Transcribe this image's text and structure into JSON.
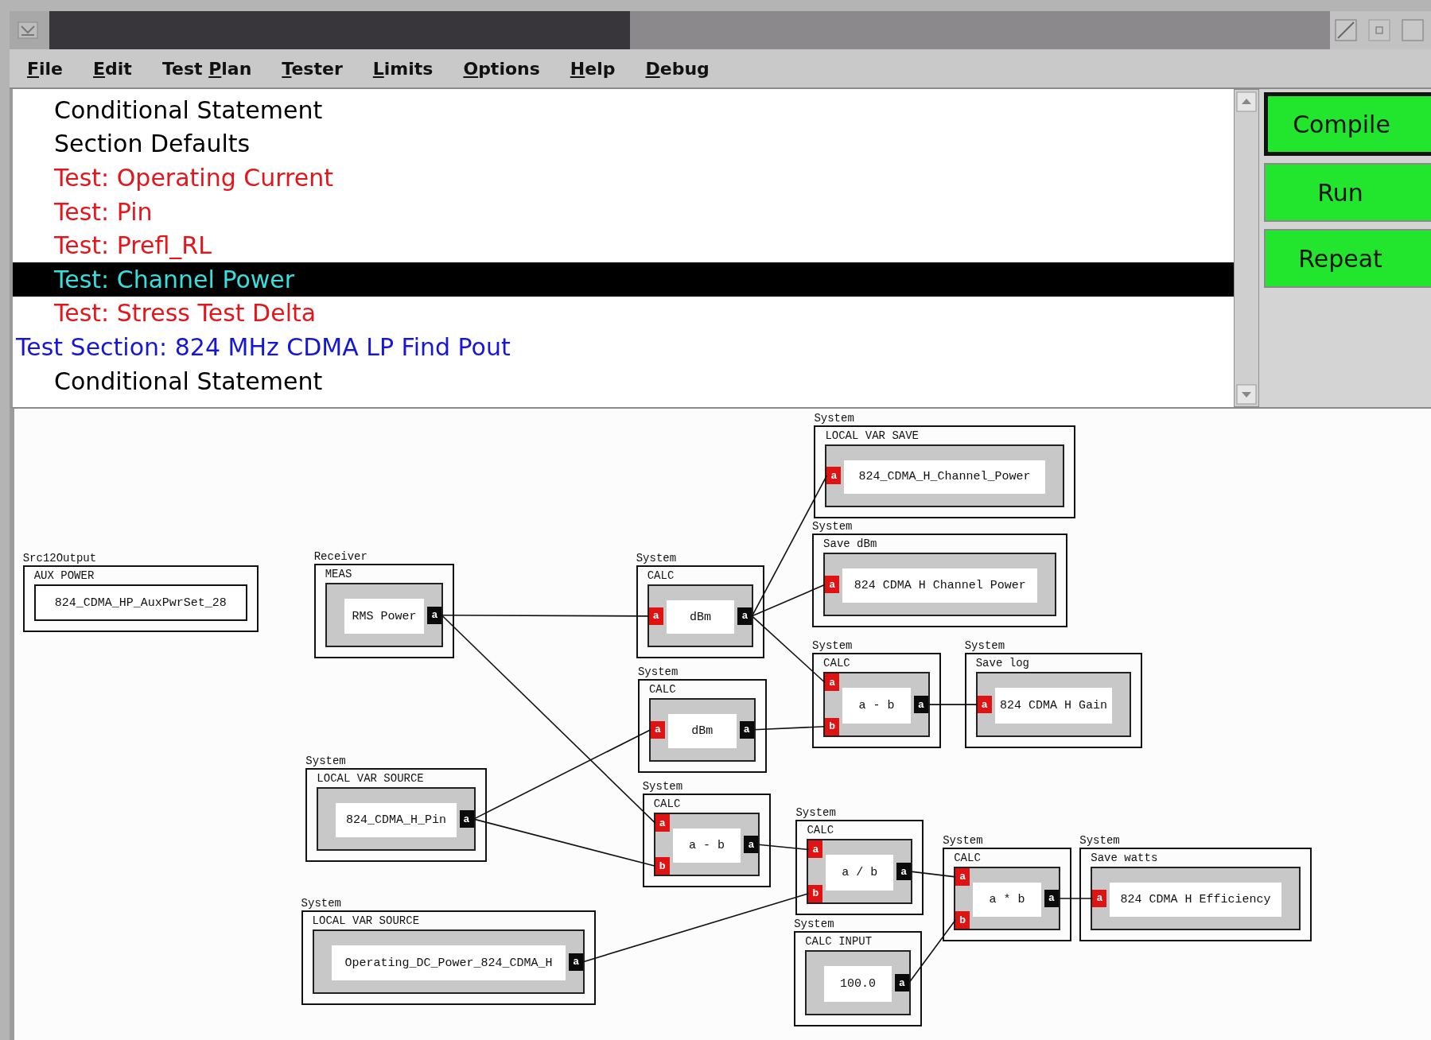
{
  "menu": [
    {
      "key": "F",
      "after": "ile"
    },
    {
      "key": "E",
      "after": "dit"
    },
    {
      "before": "Test ",
      "key": "P",
      "after": "lan"
    },
    {
      "key": "T",
      "after": "ester"
    },
    {
      "key": "L",
      "after": "imits"
    },
    {
      "key": "O",
      "after": "ptions"
    },
    {
      "key": "H",
      "after": "elp"
    },
    {
      "key": "D",
      "after": "ebug"
    }
  ],
  "plan_list": [
    {
      "label": "Conditional Statement",
      "kind": "step",
      "color": "#000000",
      "selected": false
    },
    {
      "label": "Section Defaults",
      "kind": "step",
      "color": "#000000",
      "selected": false
    },
    {
      "label": "Test: Operating Current",
      "kind": "step",
      "color": "#e3161c",
      "selected": false
    },
    {
      "label": "Test: Pin",
      "kind": "step",
      "color": "#e3161c",
      "selected": false
    },
    {
      "label": "Test: Prefl_RL",
      "kind": "step",
      "color": "#e3161c",
      "selected": false
    },
    {
      "label": "Test: Channel Power",
      "kind": "step",
      "color": "#36dede",
      "selected": true
    },
    {
      "label": "Test: Stress Test Delta",
      "kind": "step",
      "color": "#e3161c",
      "selected": false
    },
    {
      "label": "Test Section: 824 MHz CDMA LP Find Pout",
      "kind": "section",
      "color": "#1616d6",
      "selected": false
    },
    {
      "label": "Conditional Statement",
      "kind": "step",
      "color": "#000000",
      "selected": false
    }
  ],
  "actions": [
    {
      "label": "Compile",
      "default": true
    },
    {
      "label": "Run",
      "default": false
    },
    {
      "label": "Repeat",
      "default": false
    }
  ],
  "diagram": {
    "nodes": [
      {
        "kind": "plain",
        "category": "Src12Output",
        "title": "AUX POWER",
        "value": "824_CDMA_HP_AuxPwrSet_28"
      },
      {
        "kind": "block",
        "category": "Receiver",
        "title": "MEAS",
        "value": "RMS Power",
        "outputs": [
          "a"
        ]
      },
      {
        "kind": "block",
        "category": "System",
        "title": "CALC",
        "value": "dBm",
        "inputs": [
          "a"
        ],
        "outputs": [
          "a"
        ]
      },
      {
        "kind": "block",
        "category": "System",
        "title": "LOCAL VAR SAVE",
        "value": "824_CDMA_H_Channel_Power",
        "inputs": [
          "a"
        ]
      },
      {
        "kind": "block",
        "category": "System",
        "title": "Save dBm",
        "value": "824 CDMA H Channel Power",
        "inputs": [
          "a"
        ]
      },
      {
        "kind": "block",
        "category": "System",
        "title": "CALC",
        "value": "a - b",
        "inputs": [
          "a",
          "b"
        ],
        "outputs": [
          "a"
        ]
      },
      {
        "kind": "block",
        "category": "System",
        "title": "Save log",
        "value": "824 CDMA H Gain",
        "inputs": [
          "a"
        ]
      },
      {
        "kind": "block",
        "category": "System",
        "title": "CALC",
        "value": "dBm",
        "inputs": [
          "a"
        ],
        "outputs": [
          "a"
        ]
      },
      {
        "kind": "block",
        "category": "System",
        "title": "LOCAL VAR SOURCE",
        "value": "824_CDMA_H_Pin",
        "outputs": [
          "a"
        ]
      },
      {
        "kind": "block",
        "category": "System",
        "title": "CALC",
        "value": "a - b",
        "inputs": [
          "a",
          "b"
        ],
        "outputs": [
          "a"
        ]
      },
      {
        "kind": "block",
        "category": "System",
        "title": "CALC",
        "value": "a / b",
        "inputs": [
          "a",
          "b"
        ],
        "outputs": [
          "a"
        ]
      },
      {
        "kind": "block",
        "category": "System",
        "title": "LOCAL VAR SOURCE",
        "value": "Operating_DC_Power_824_CDMA_H",
        "outputs": [
          "a"
        ]
      },
      {
        "kind": "block",
        "category": "System",
        "title": "CALC INPUT",
        "value": "100.0",
        "outputs": [
          "a"
        ]
      },
      {
        "kind": "block",
        "category": "System",
        "title": "CALC",
        "value": "a * b",
        "inputs": [
          "a",
          "b"
        ],
        "outputs": [
          "a"
        ]
      },
      {
        "kind": "block",
        "category": "System",
        "title": "Save watts",
        "value": "824 CDMA H Efficiency",
        "inputs": [
          "a"
        ]
      }
    ]
  }
}
